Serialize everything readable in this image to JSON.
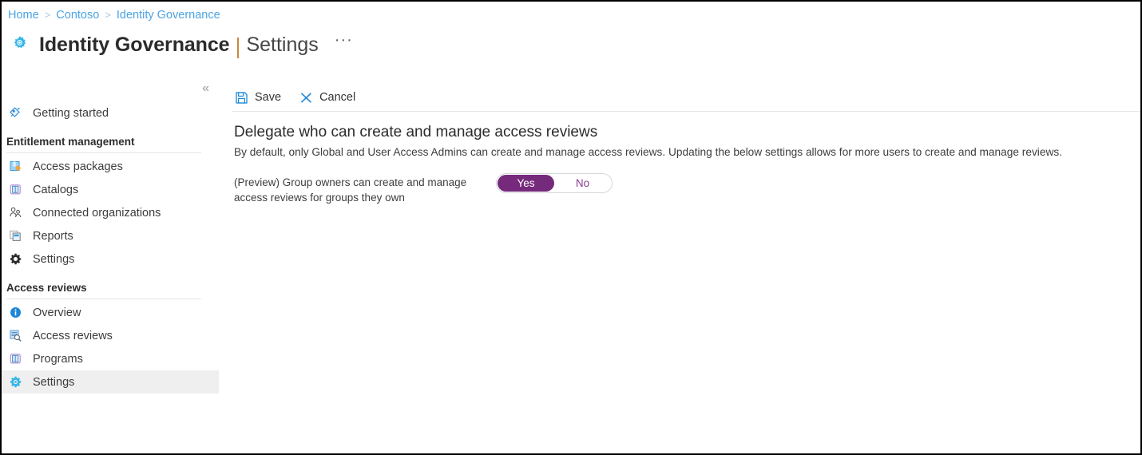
{
  "breadcrumb": {
    "items": [
      "Home",
      "Contoso",
      "Identity Governance"
    ],
    "separator": ">"
  },
  "header": {
    "icon": "governance-gear-icon",
    "title": "Identity Governance",
    "subtitle": "Settings",
    "more_menu": "···"
  },
  "sidebar": {
    "collapse_label": "«",
    "top_items": [
      {
        "label": "Getting started",
        "icon": "rocket-icon",
        "selected": false
      }
    ],
    "sections": [
      {
        "title": "Entitlement management",
        "items": [
          {
            "label": "Access packages",
            "icon": "package-icon",
            "selected": false
          },
          {
            "label": "Catalogs",
            "icon": "book-icon",
            "selected": false
          },
          {
            "label": "Connected organizations",
            "icon": "people-icon",
            "selected": false
          },
          {
            "label": "Reports",
            "icon": "reports-icon",
            "selected": false
          },
          {
            "label": "Settings",
            "icon": "gear-icon",
            "selected": false
          }
        ]
      },
      {
        "title": "Access reviews",
        "items": [
          {
            "label": "Overview",
            "icon": "info-circle-icon",
            "selected": false
          },
          {
            "label": "Access reviews",
            "icon": "review-search-icon",
            "selected": false
          },
          {
            "label": "Programs",
            "icon": "book-icon",
            "selected": false
          },
          {
            "label": "Settings",
            "icon": "gear-blue-icon",
            "selected": true
          }
        ]
      }
    ]
  },
  "toolbar": {
    "save_label": "Save",
    "save_icon": "save-disk-icon",
    "cancel_label": "Cancel",
    "cancel_icon": "close-x-icon"
  },
  "main": {
    "section_title": "Delegate who can create and manage access reviews",
    "section_description": "By default, only Global and User Access Admins can create and manage access reviews. Updating the below settings allows for more users to create and manage reviews.",
    "setting": {
      "label": "(Preview) Group owners can create and manage access reviews for groups they own",
      "toggle": {
        "yes_label": "Yes",
        "no_label": "No",
        "value": "Yes"
      }
    }
  },
  "colors": {
    "link": "#4ba3e3",
    "accent_purple": "#762a7c",
    "azure_blue": "#0078d4",
    "selected_row": "#efefef",
    "title_pipe": "#c7883c"
  }
}
